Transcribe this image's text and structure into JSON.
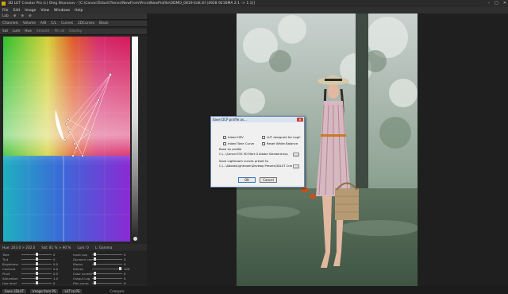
{
  "window": {
    "title": "3D LUT Creator Pro (c) Oleg Sharonov - [C:\\Canon\\ToSort\\Trener\\NewFrom\\Price\\NewProfile\\ODMO_0819-Edit.tif (4928 9216MA 2:1 -> 1.1)]",
    "controls": [
      "–",
      "□",
      "✕"
    ]
  },
  "menu": [
    "File",
    "Edit",
    "Image",
    "View",
    "Windows",
    "Help"
  ],
  "left_panel": {
    "toolbar1": [
      "Lab",
      "⊕",
      "⊕",
      "⊕"
    ],
    "toolbar2": [
      "Channels",
      "Volume",
      "A/B",
      "C/L",
      "Curves",
      "2DCurves",
      "Black"
    ],
    "toolbar3": [
      "Sat",
      "Lum",
      "Hue",
      "Smooth",
      "Pin all",
      "Display"
    ],
    "status": {
      "hue": "Hue: 203.0 > 202.0",
      "sat": "Sat: 81 % > 90 %",
      "lum": "Lum: 0",
      "gamma": "L: Gamma"
    },
    "sliders_left": [
      {
        "label": "Tone",
        "value": "0"
      },
      {
        "label": "Tint",
        "value": "0"
      },
      {
        "label": "Brightness",
        "value": "0.0"
      },
      {
        "label": "Contrast",
        "value": "0.0"
      },
      {
        "label": "Pivot",
        "value": "0.5"
      },
      {
        "label": "Saturation",
        "value": "1.0"
      },
      {
        "label": "Hue level",
        "value": "0"
      }
    ],
    "sliders_right": [
      {
        "label": "Input Log",
        "value": "0"
      },
      {
        "label": "Dynamic range",
        "value": "0"
      },
      {
        "label": "Blacks",
        "value": "0"
      },
      {
        "label": "Whites",
        "value": "100"
      },
      {
        "label": "Color accent",
        "value": "0"
      },
      {
        "label": "Output Log",
        "value": "0"
      },
      {
        "label": "Film curve",
        "value": "0"
      }
    ],
    "bottom_tabs": [
      "Save 3DLUT",
      "Image from PS",
      "LUT to PS"
    ],
    "compare_label": "Compare"
  },
  "dialog": {
    "title": "Save DCP profile as...",
    "close": "✕",
    "checkboxes": [
      {
        "label": "Inbed HSV",
        "checked": true
      },
      {
        "label": "LUT designed for LogC",
        "checked": false
      },
      {
        "label": "Inbed Tone Curve",
        "checked": true
      },
      {
        "label": "Reset White Balance",
        "checked": true
      }
    ],
    "base_label": "Base on profile",
    "base_path": "C:\\...\\Canon EOS 5D Mark II Adobe Standard.dcp",
    "preset_label": "Save Lightroom curves preset to",
    "preset_path": "C:\\...\\Adobe\\Lightroom\\Develop Presets\\3DLUT Creator",
    "browse": "...",
    "ok": "OK",
    "cancel": "Cancel"
  },
  "colors": {
    "dialog_border": "#6a8ab5",
    "ok_border": "#3b78c4",
    "app_bg": "#1f1f1f",
    "panel_bg": "#252525"
  }
}
